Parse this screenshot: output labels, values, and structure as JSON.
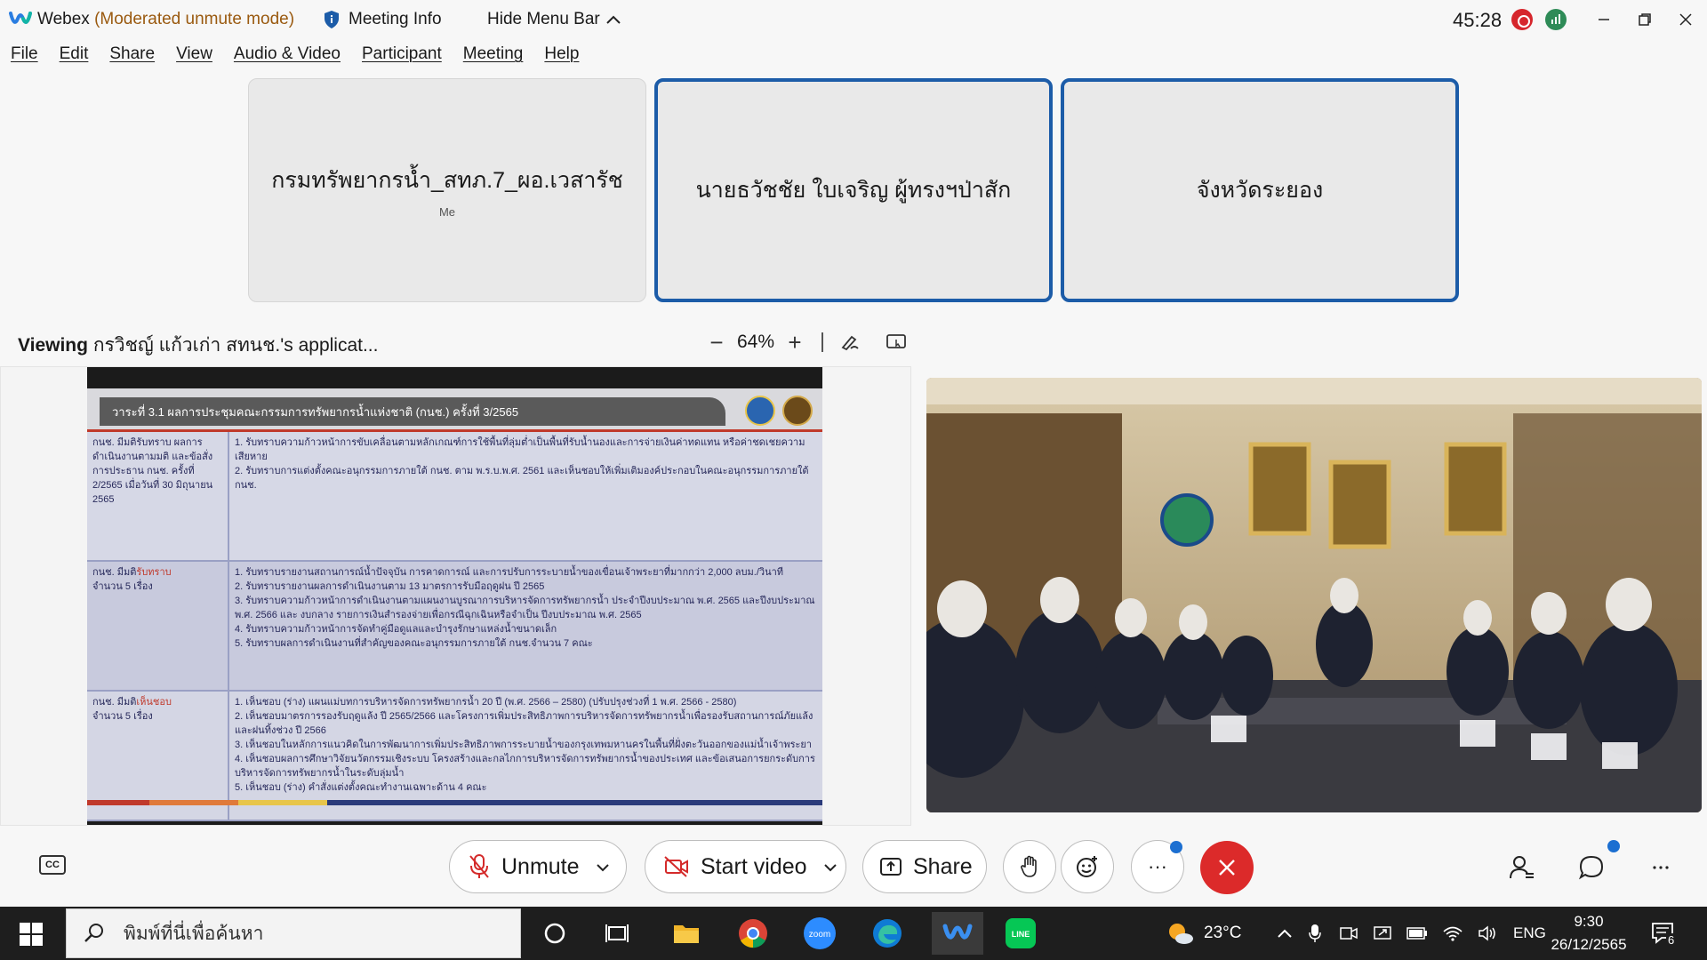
{
  "titlebar": {
    "app_name": "Webex",
    "mode": "(Moderated unmute mode)",
    "meeting_info": "Meeting Info",
    "hide_menu": "Hide Menu Bar",
    "timer": "45:28"
  },
  "menu": [
    "File",
    "Edit",
    "Share",
    "View",
    "Audio & Video",
    "Participant",
    "Meeting",
    "Help"
  ],
  "tiles": [
    {
      "name": "กรมทรัพยากรน้ำ_สทภ.7_ผอ.เวสารัช",
      "sub": "Me"
    },
    {
      "name": "นายธวัชชัย ใบเจริญ ผู้ทรงฯป่าสัก",
      "sub": ""
    },
    {
      "name": "จังหวัดระยอง",
      "sub": ""
    }
  ],
  "viewing": {
    "prefix": "Viewing",
    "text": "กรวิชญ์ แก้วเก่า สทนช.'s applicat..."
  },
  "zoom": {
    "minus": "−",
    "value": "64%",
    "plus": "+"
  },
  "slide": {
    "header": "วาระที่ 3.1 ผลการประชุมคณะกรรมการทรัพยากรน้ำแห่งชาติ (กนช.) ครั้งที่ 3/2565",
    "rows": [
      {
        "left": "กนช. มีมติรับทราบ ผลการดำเนินงานตามมติ และข้อสั่งการประธาน กนช. ครั้งที่ 2/2565 เมื่อวันที่ 30 มิถุนายน 2565",
        "items": [
          "1. รับทราบความก้าวหน้าการขับเคลื่อนตามหลักเกณฑ์การใช้พื้นที่ลุ่มต่ำเป็นพื้นที่รับน้ำนองและการจ่ายเงินค่าทดแทน หรือค่าชดเชยความเสียหาย",
          "2. รับทราบการแต่งตั้งคณะอนุกรรมการภายใต้ กนช. ตาม พ.ร.บ.พ.ศ. 2561 และเห็นชอบให้เพิ่มเติมองค์ประกอบในคณะอนุกรรมการภายใต้ กนช."
        ]
      },
      {
        "left_a": "กนช. มีมติ",
        "left_red": "รับทราบ",
        "left_b": "จำนวน 5 เรื่อง",
        "items": [
          "1. รับทราบรายงานสถานการณ์น้ำปัจจุบัน การคาดการณ์ และการปรับการระบายน้ำของเขื่อนเจ้าพระยาที่มากกว่า 2,000 ลบม./วินาที",
          "2. รับทราบรายงานผลการดำเนินงานตาม 13 มาตรการรับมือฤดูฝน ปี 2565",
          "3. รับทราบความก้าวหน้าการดำเนินงานตามแผนงานบูรณาการบริหารจัดการทรัพยากรน้ำ ประจำปีงบประมาณ พ.ศ. 2565 และปีงบประมาณ พ.ศ. 2566 และ งบกลาง รายการเงินสำรองจ่ายเพื่อกรณีฉุกเฉินหรือจำเป็น ปีงบประมาณ พ.ศ. 2565",
          "4. รับทราบความก้าวหน้าการจัดทำคู่มือดูแลและบำรุงรักษาแหล่งน้ำขนาดเล็ก",
          "5. รับทราบผลการดำเนินงานที่สำคัญของคณะอนุกรรมการภายใต้ กนช.จำนวน 7 คณะ"
        ]
      },
      {
        "left_a": "กนช. มีมติ",
        "left_red": "เห็นชอบ",
        "left_b": "จำนวน 5 เรื่อง",
        "items": [
          "1. เห็นชอบ (ร่าง) แผนแม่บทการบริหารจัดการทรัพยากรน้ำ 20 ปี (พ.ศ. 2566 – 2580) (ปรับปรุงช่วงที่ 1 พ.ศ. 2566 - 2580)",
          "2. เห็นชอบมาตรการรองรับฤดูแล้ง ปี 2565/2566 และโครงการเพิ่มประสิทธิภาพการบริหารจัดการทรัพยากรน้ำเพื่อรองรับสถานการณ์ภัยแล้งและฝนทิ้งช่วง ปี 2566",
          "3. เห็นชอบในหลักการแนวคิดในการพัฒนาการเพิ่มประสิทธิภาพการระบายน้ำของกรุงเทพมหานครในพื้นที่ฝั่งตะวันออกของแม่น้ำเจ้าพระยา",
          "4. เห็นชอบผลการศึกษาวิจัยนวัตกรรมเชิงระบบ โครงสร้างและกลไกการบริหารจัดการทรัพยากรน้ำของประเทศ และข้อเสนอการยกระดับการบริหารจัดการทรัพยากรน้ำในระดับลุ่มน้ำ",
          "5. เห็นชอบ (ร่าง) คำสั่งแต่งตั้งคณะทำงานเฉพาะด้าน 4 คณะ"
        ]
      }
    ]
  },
  "controls": {
    "cc": "CC",
    "unmute": "Unmute",
    "start_video": "Start video",
    "share": "Share",
    "more": "···"
  },
  "taskbar": {
    "search_placeholder": "พิมพ์ที่นี่เพื่อค้นหา",
    "zoom_label": "zoom",
    "line_label": "LINE",
    "temp": "23°C",
    "lang": "ENG",
    "time": "9:30",
    "date": "26/12/2565",
    "notif_count": "6"
  },
  "colors": {
    "accent_blue": "#1c5ca8",
    "end_red": "#dc2a2a",
    "record_red": "#d6262c",
    "mode_text": "#9a5a10"
  }
}
